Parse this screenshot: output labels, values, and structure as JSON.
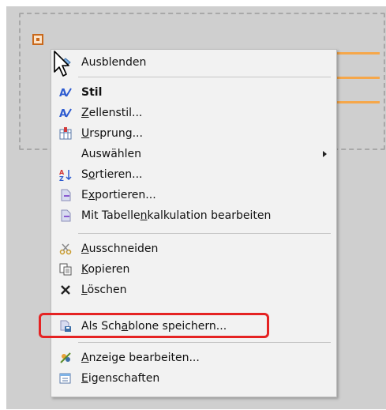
{
  "menu": {
    "items": [
      {
        "label_pre": "",
        "label_u": "",
        "label_post": "Ausblenden",
        "icon": "hide-icon",
        "bold": false
      },
      {
        "label_pre": "",
        "label_u": "",
        "label_post": "Stil",
        "icon": "style-icon",
        "bold": true
      },
      {
        "label_pre": "",
        "label_u": "Z",
        "label_post": "ellenstil...",
        "icon": "cell-style-icon",
        "bold": false
      },
      {
        "label_pre": "",
        "label_u": "U",
        "label_post": "rsprung...",
        "icon": "origin-icon",
        "bold": false
      },
      {
        "label_pre": "Auswählen",
        "label_u": "",
        "label_post": "",
        "icon": "",
        "bold": false,
        "submenu": true
      },
      {
        "label_pre": "S",
        "label_u": "o",
        "label_post": "rtieren...",
        "icon": "sort-icon",
        "bold": false
      },
      {
        "label_pre": "E",
        "label_u": "x",
        "label_post": "portieren...",
        "icon": "export-icon",
        "bold": false
      },
      {
        "label_pre": "Mit Tabelle",
        "label_u": "n",
        "label_post": "kalkulation bearbeiten",
        "icon": "spreadsheet-icon",
        "bold": false
      },
      {
        "label_pre": "",
        "label_u": "A",
        "label_post": "usschneiden",
        "icon": "cut-icon",
        "bold": false
      },
      {
        "label_pre": "",
        "label_u": "K",
        "label_post": "opieren",
        "icon": "copy-icon",
        "bold": false
      },
      {
        "label_pre": "",
        "label_u": "L",
        "label_post": "öschen",
        "icon": "delete-icon",
        "bold": false
      },
      {
        "label_pre": "Als Sch",
        "label_u": "a",
        "label_post": "blone speichern...",
        "icon": "save-template-icon",
        "bold": false
      },
      {
        "label_pre": "",
        "label_u": "A",
        "label_post": "nzeige bearbeiten...",
        "icon": "edit-display-icon",
        "bold": false
      },
      {
        "label_pre": "",
        "label_u": "E",
        "label_post": "igenschaften",
        "icon": "properties-icon",
        "bold": false
      }
    ]
  },
  "colors": {
    "highlight": "#e52323",
    "accent_orange": "#f6a74a",
    "menu_bg": "#f2f2f2"
  }
}
